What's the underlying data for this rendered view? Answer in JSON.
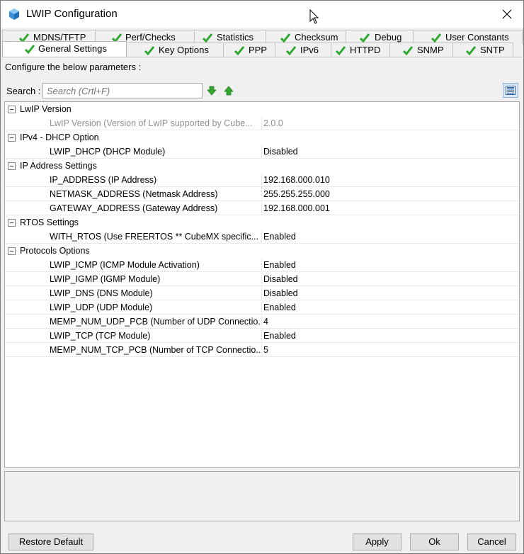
{
  "window": {
    "title": "LWIP Configuration"
  },
  "tabs": {
    "row1": [
      {
        "label": "MDNS/TFTP"
      },
      {
        "label": "Perf/Checks"
      },
      {
        "label": "Statistics"
      },
      {
        "label": "Checksum"
      },
      {
        "label": "Debug"
      },
      {
        "label": "User Constants"
      }
    ],
    "row2": [
      {
        "label": "General Settings"
      },
      {
        "label": "Key Options"
      },
      {
        "label": "PPP"
      },
      {
        "label": "IPv6"
      },
      {
        "label": "HTTPD"
      },
      {
        "label": "SNMP"
      },
      {
        "label": "SNTP"
      }
    ],
    "active": "General Settings"
  },
  "panel": {
    "instruction": "Configure the below parameters :",
    "search_label": "Search :",
    "search_placeholder": "Search (Crtl+F)"
  },
  "groups": [
    {
      "name": "LwIP Version",
      "params": [
        {
          "name": "LwIP Version (Version of LwIP supported by Cube...",
          "value": "2.0.0"
        }
      ]
    },
    {
      "name": "IPv4 - DHCP Option",
      "params": [
        {
          "name": "LWIP_DHCP (DHCP Module)",
          "value": "Disabled"
        }
      ]
    },
    {
      "name": "IP Address Settings",
      "params": [
        {
          "name": "IP_ADDRESS (IP Address)",
          "value": "192.168.000.010"
        },
        {
          "name": "NETMASK_ADDRESS (Netmask Address)",
          "value": "255.255.255.000"
        },
        {
          "name": "GATEWAY_ADDRESS (Gateway Address)",
          "value": "192.168.000.001"
        }
      ]
    },
    {
      "name": "RTOS Settings",
      "params": [
        {
          "name": "WITH_RTOS (Use FREERTOS ** CubeMX specific...",
          "value": "Enabled"
        }
      ]
    },
    {
      "name": "Protocols Options",
      "params": [
        {
          "name": "LWIP_ICMP (ICMP Module Activation)",
          "value": "Enabled"
        },
        {
          "name": "LWIP_IGMP (IGMP Module)",
          "value": "Disabled"
        },
        {
          "name": "LWIP_DNS (DNS Module)",
          "value": "Disabled"
        },
        {
          "name": "LWIP_UDP (UDP Module)",
          "value": "Enabled"
        },
        {
          "name": "MEMP_NUM_UDP_PCB (Number of UDP Connectio...",
          "value": "4"
        },
        {
          "name": "LWIP_TCP (TCP Module)",
          "value": "Enabled"
        },
        {
          "name": "MEMP_NUM_TCP_PCB (Number of TCP Connectio...",
          "value": "5"
        }
      ]
    }
  ],
  "buttons": {
    "restore_default": "Restore Default",
    "apply": "Apply",
    "ok": "Ok",
    "cancel": "Cancel"
  },
  "colors": {
    "check_green": "#2fa82f",
    "arrow_green": "#36a832",
    "disabled_text": "#909090"
  }
}
